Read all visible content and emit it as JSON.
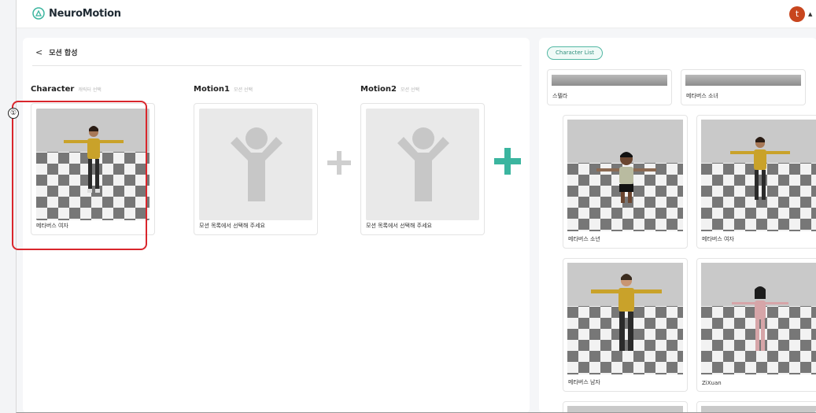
{
  "app": {
    "brand": "NeuroMotion",
    "user_initial": "t"
  },
  "page": {
    "back_label": "모션 합성",
    "step_badge": "①"
  },
  "slots": [
    {
      "title": "Character",
      "sub": "캐릭터 선택",
      "card_label": "메타버스 여자",
      "filled": true
    },
    {
      "title": "Motion1",
      "sub": "모션 선택",
      "card_label": "모션 목록에서 선택해 주세요",
      "filled": false
    },
    {
      "title": "Motion2",
      "sub": "모션 선택",
      "card_label": "모션 목록에서 선택해 주세요",
      "filled": false
    }
  ],
  "right_panel": {
    "chip_label": "Character List",
    "characters": [
      {
        "label": "스텔라"
      },
      {
        "label": "메타버스 소녀"
      },
      {
        "label": "메타버스 소년"
      },
      {
        "label": "메타버스 여자"
      },
      {
        "label": "메타버스 남자"
      },
      {
        "label": "ZiXuan"
      }
    ]
  },
  "colors": {
    "accent": "#3bb59f",
    "highlight": "#d9262c",
    "avatar": "#c8461e"
  }
}
